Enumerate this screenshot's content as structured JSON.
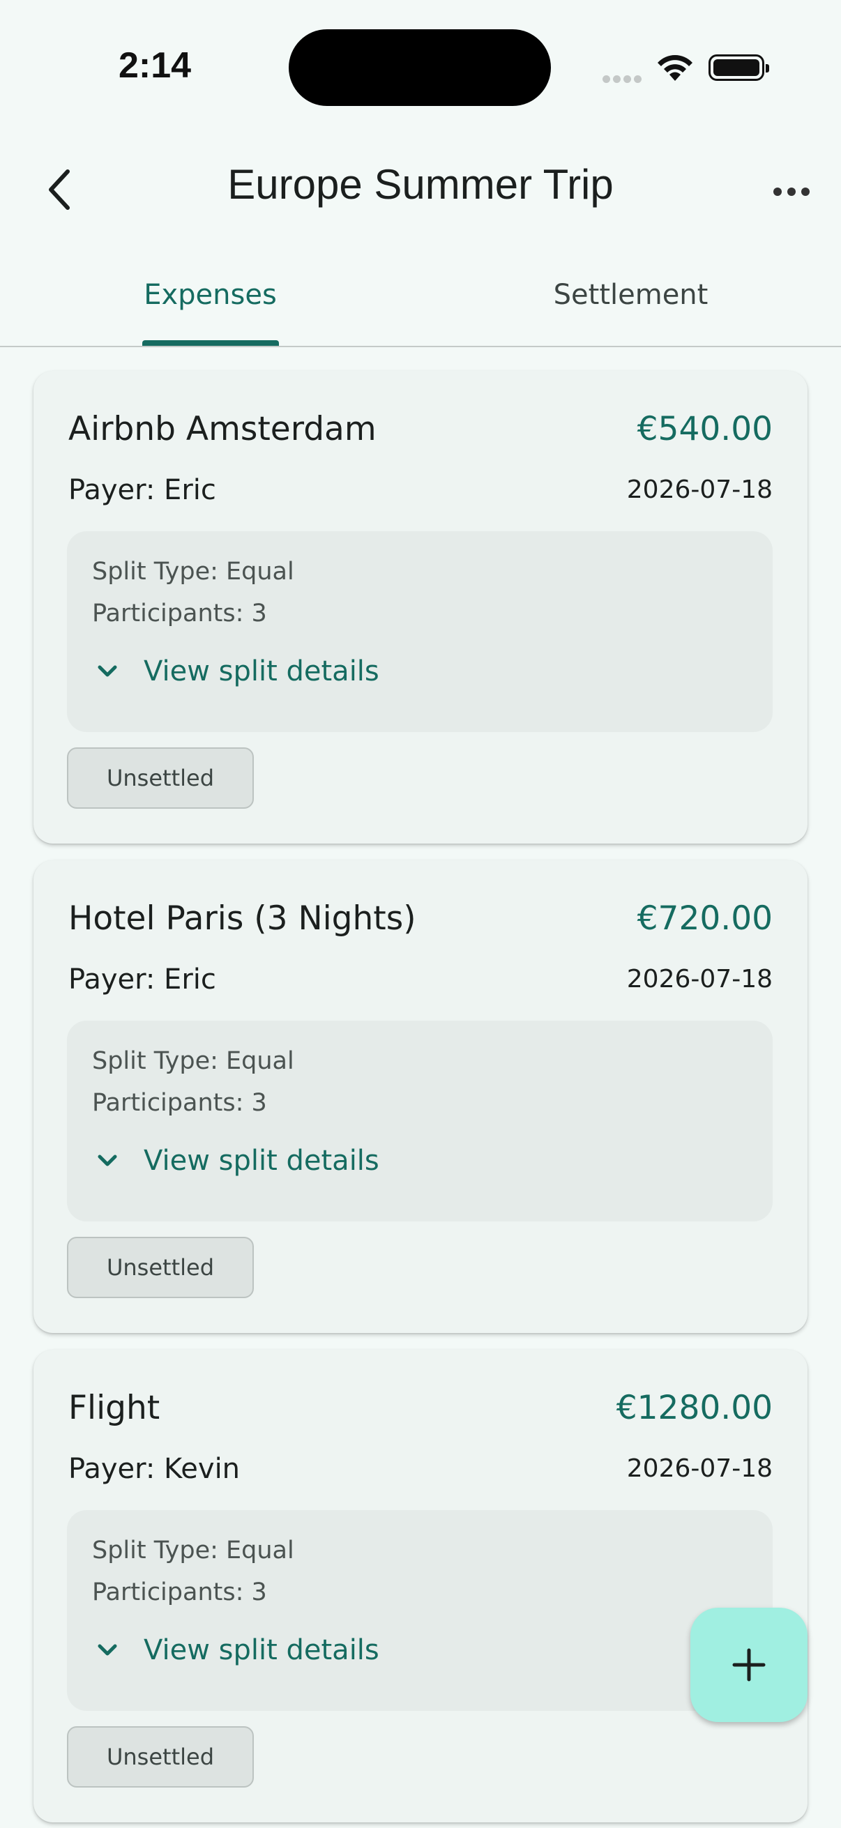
{
  "status_bar": {
    "time": "2:14"
  },
  "header": {
    "title": "Europe Summer Trip"
  },
  "tabs": [
    {
      "label": "Expenses",
      "selected": true
    },
    {
      "label": "Settlement",
      "selected": false
    }
  ],
  "expenses": [
    {
      "title": "Airbnb Amsterdam",
      "amount": "€540.00",
      "payer": "Payer: Eric",
      "date": "2026-07-18",
      "split_type": "Split Type: Equal",
      "participants": "Participants: 3",
      "split_details_label": "View split details",
      "status": "Unsettled"
    },
    {
      "title": "Hotel Paris (3 Nights)",
      "amount": "€720.00",
      "payer": "Payer: Eric",
      "date": "2026-07-18",
      "split_type": "Split Type: Equal",
      "participants": "Participants: 3",
      "split_details_label": "View split details",
      "status": "Unsettled"
    },
    {
      "title": "Flight",
      "amount": "€1280.00",
      "payer": "Payer: Kevin",
      "date": "2026-07-18",
      "split_type": "Split Type: Equal",
      "participants": "Participants: 3",
      "split_details_label": "View split details",
      "status": "Unsettled"
    }
  ],
  "colors": {
    "accent": "#156b60",
    "background": "#f3f9f7",
    "card": "#eef4f2",
    "fab": "#a0efe1"
  },
  "icons": {
    "back": "chevron-left-icon",
    "more": "more-horizontal-icon",
    "expand": "chevron-down-icon",
    "add": "plus-icon"
  }
}
